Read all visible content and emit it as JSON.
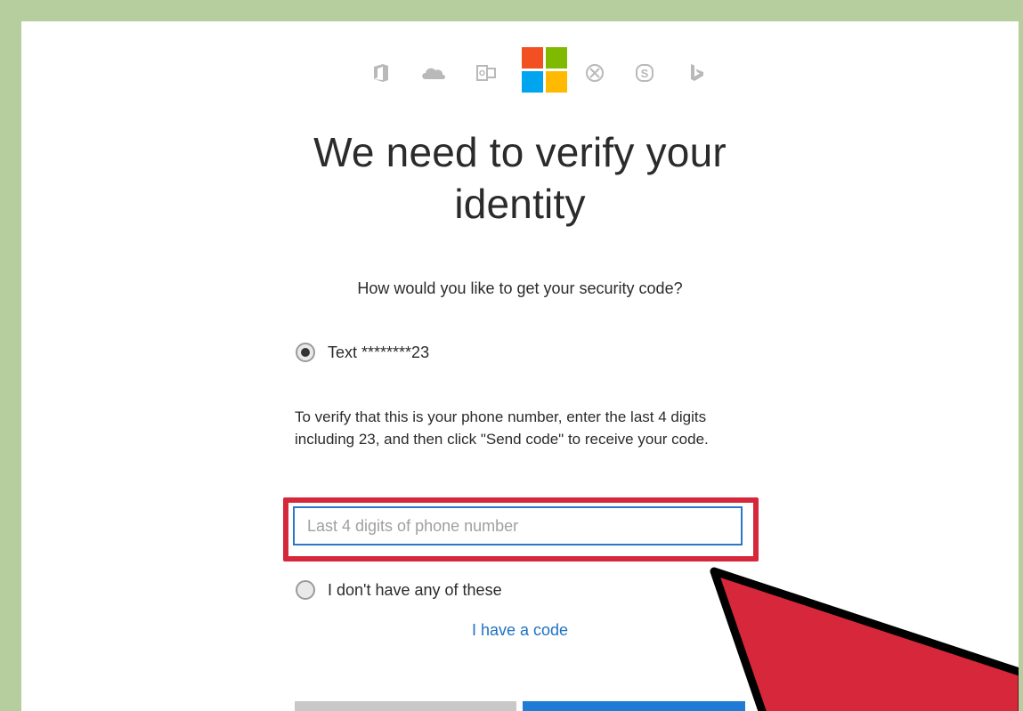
{
  "header": {
    "product_icons": [
      "office-icon",
      "onedrive-icon",
      "outlook-icon",
      "microsoft-logo",
      "xbox-icon",
      "skype-icon",
      "bing-icon"
    ],
    "logo_colors": [
      "#f25022",
      "#7fba00",
      "#00a4ef",
      "#ffb900"
    ]
  },
  "title": "We need to verify your identity",
  "question": "How would you like to get your security code?",
  "options": {
    "text_option_label": "Text ********23",
    "none_option_label": "I don't have any of these"
  },
  "instructions": "To verify that this is your phone number, enter the last 4 digits including 23, and then click \"Send code\" to receive your code.",
  "phone_input": {
    "placeholder": "Last 4 digits of phone number",
    "value": ""
  },
  "have_code_link": "I have a code",
  "colors": {
    "highlight": "#d6283a",
    "accent": "#1f7bd6",
    "frame": "#b6cd9e"
  }
}
